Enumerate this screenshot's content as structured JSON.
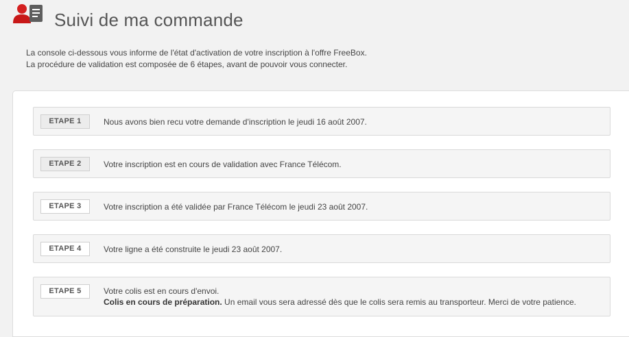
{
  "header": {
    "title": "Suivi de ma commande",
    "icon": "user-document-icon"
  },
  "intro": {
    "line1": "La console ci-dessous vous informe de l'état d'activation de votre inscription à l'offre FreeBox.",
    "line2": "La procédure de validation est composée de 6 étapes, avant de pouvoir vous connecter."
  },
  "steps": [
    {
      "label": "ETAPE 1",
      "text": "Nous avons bien recu votre demande d'inscription le jeudi 16 août 2007."
    },
    {
      "label": "ETAPE 2",
      "text": "Votre inscription est en cours de validation avec France Télécom."
    },
    {
      "label": "ETAPE 3",
      "text": "Votre inscription a été validée par France Télécom le jeudi 23 août 2007."
    },
    {
      "label": "ETAPE 4",
      "text": "Votre ligne a été construite le jeudi 23 août 2007."
    },
    {
      "label": "ETAPE 5",
      "text": "Votre colis est en cours d'envoi.",
      "detail_bold": "Colis en cours de préparation.",
      "detail": " Un email vous sera adressé dès que le colis sera remis au transporteur. Merci de votre patience."
    }
  ],
  "colors": {
    "accent": "#cc1f1f",
    "background": "#f2f2f2",
    "panel": "#ffffff"
  }
}
